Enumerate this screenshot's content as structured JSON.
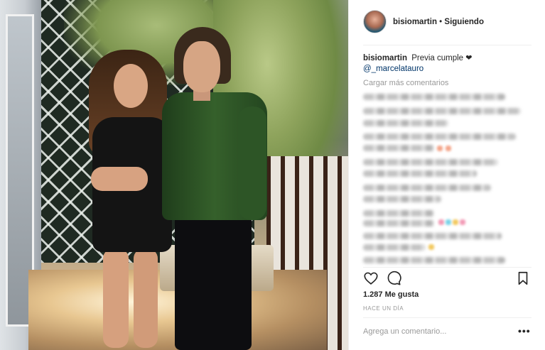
{
  "post": {
    "header": {
      "username": "bisiomartin",
      "separator": " • ",
      "follow_status": "Siguiendo"
    },
    "caption": {
      "username": "bisiomartin",
      "text": "Previa cumple",
      "emoji": "❤",
      "mention": "@_marcelatauro"
    },
    "load_more_comments": "Cargar más comentarios",
    "likes": "1.287 Me gusta",
    "timestamp": "HACE UN DÍA",
    "comment_placeholder": "Agrega un comentario...",
    "more_options": "•••"
  },
  "icons": {
    "like": "heart-outline-icon",
    "comment": "speech-bubble-icon",
    "save": "bookmark-icon",
    "more": "ellipsis-icon"
  },
  "colors": {
    "mention_link": "#003569",
    "muted_text": "#999999",
    "primary_text": "#262626"
  }
}
